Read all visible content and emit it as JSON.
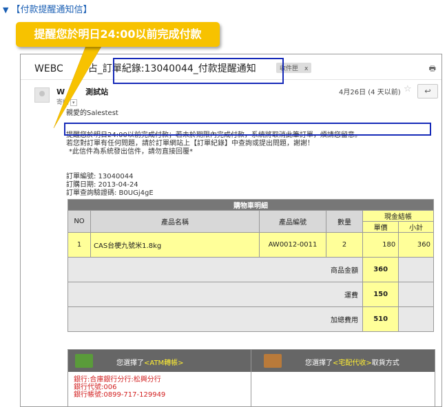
{
  "heading": {
    "marker": "▼",
    "text": "【付款提醒通知信】"
  },
  "callout": {
    "text": "提醒您於明日24:00以前完成付款"
  },
  "email": {
    "subject": "WEBC      站_訂單紀錄:13040044_付款提醒通知",
    "subject_visible": [
      "WEBC",
      "占_訂單紀錄:13040044_付款提醒通知"
    ],
    "label_chip": "收件匣　x",
    "sender_name": "W     測試站",
    "sender_visible": [
      "W",
      "測試站"
    ],
    "to_me": "寄給",
    "date": "4月26日 (4 天以前)",
    "greeting": "親愛的Salestest",
    "body_lines": [
      "提醒您於明日24:00以前完成付款；若未於期限內完成付款，系統將取消此筆訂單，煩請您留意。",
      "若您對訂單有任何問題，請於訂單網站上【訂單紀錄】中查詢或提出問題，謝謝！",
      "*此信件為系統發出信件，請勿直接回覆*"
    ],
    "order_info": [
      "訂單編號: 13040044",
      "訂購日期: 2013-04-24",
      "訂單查詢驗證碼: B0UGj4gE"
    ]
  },
  "cart": {
    "title": "購物車明細",
    "headers": {
      "no": "NO",
      "name": "產品名稱",
      "code": "產品編號",
      "qty": "數量",
      "cash": "現金結帳",
      "unit": "單價",
      "subtotal": "小計"
    },
    "item": {
      "no": "1",
      "name": "CAS台梗九號米1.8kg",
      "code": "AW0012-0011",
      "qty": "2",
      "unit": "180",
      "subtotal": "360"
    },
    "totals": [
      {
        "label": "商品金額",
        "value": "360"
      },
      {
        "label": "運費",
        "value": "150"
      },
      {
        "label": "加總費用",
        "value": "510"
      }
    ]
  },
  "payment": {
    "left": {
      "prefix": "您選擇了",
      "method": "<ATM轉帳>",
      "suffix": ""
    },
    "right": {
      "prefix": "您選擇了",
      "method": "<宅配代收>",
      "suffix": "取貨方式"
    },
    "bank_lines": [
      "銀行:合庫銀行分行:松興分行",
      "銀行代號:006",
      "銀行帳號:0899-717-129949"
    ]
  },
  "colors": {
    "callout": "#f7c200",
    "highlight_box": "#1529b8",
    "cart_yellow": "#ffff99",
    "heading": "#1a5fb4",
    "bank_text": "#d21f1f"
  }
}
